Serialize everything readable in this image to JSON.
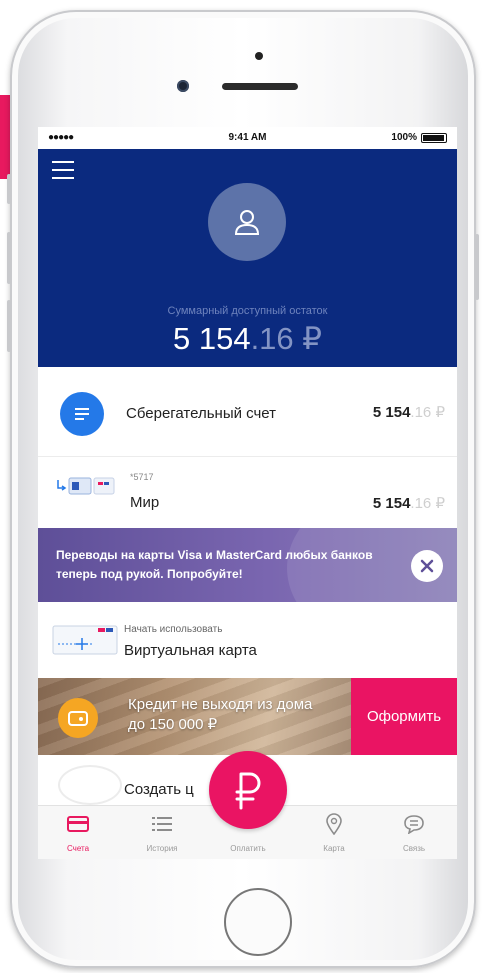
{
  "colors": {
    "header_bg": "#0b2a7f",
    "accent": "#ea1463",
    "account_icon": "#2479e8",
    "promo_bg": "#6b59a4",
    "credit_icon": "#f5a623"
  },
  "status_bar": {
    "signal": "●●●●● ",
    "time": "9:41 AM",
    "battery": "100%"
  },
  "header": {
    "menu_icon": "hamburger-icon",
    "avatar_icon": "user-icon",
    "balance_caption": "Суммарный доступный остаток",
    "balance_int": "5 154",
    "balance_frac": ".16 ₽"
  },
  "accounts": {
    "savings": {
      "icon": "document-icon",
      "name": "Сберегательный счет",
      "amount_int": "5 154",
      "amount_frac": ".16 ₽"
    },
    "card": {
      "mask": "*5717",
      "name": "Мир",
      "amount_int": "5 154",
      "amount_frac": ".16 ₽"
    }
  },
  "promo": {
    "text": "Переводы на карты Visa и MasterCard любых банков теперь под рукой. Попробуйте!",
    "close_icon": "close-icon"
  },
  "virtual_card": {
    "caption": "Начать использовать",
    "name": "Виртуальная карта"
  },
  "credit": {
    "text": "Кредит не выходя из дома до 150 000 ₽",
    "button": "Оформить",
    "icon": "wallet-icon"
  },
  "create": {
    "name": "Создать ц"
  },
  "tabbar": {
    "tabs": [
      {
        "label": "Счета",
        "icon": "card-icon",
        "active": true
      },
      {
        "label": "История",
        "icon": "list-icon"
      },
      {
        "label": "Оплатить",
        "icon": "ruble-icon"
      },
      {
        "label": "Карта",
        "icon": "map-pin-icon"
      },
      {
        "label": "Связь",
        "icon": "chat-icon"
      }
    ]
  }
}
